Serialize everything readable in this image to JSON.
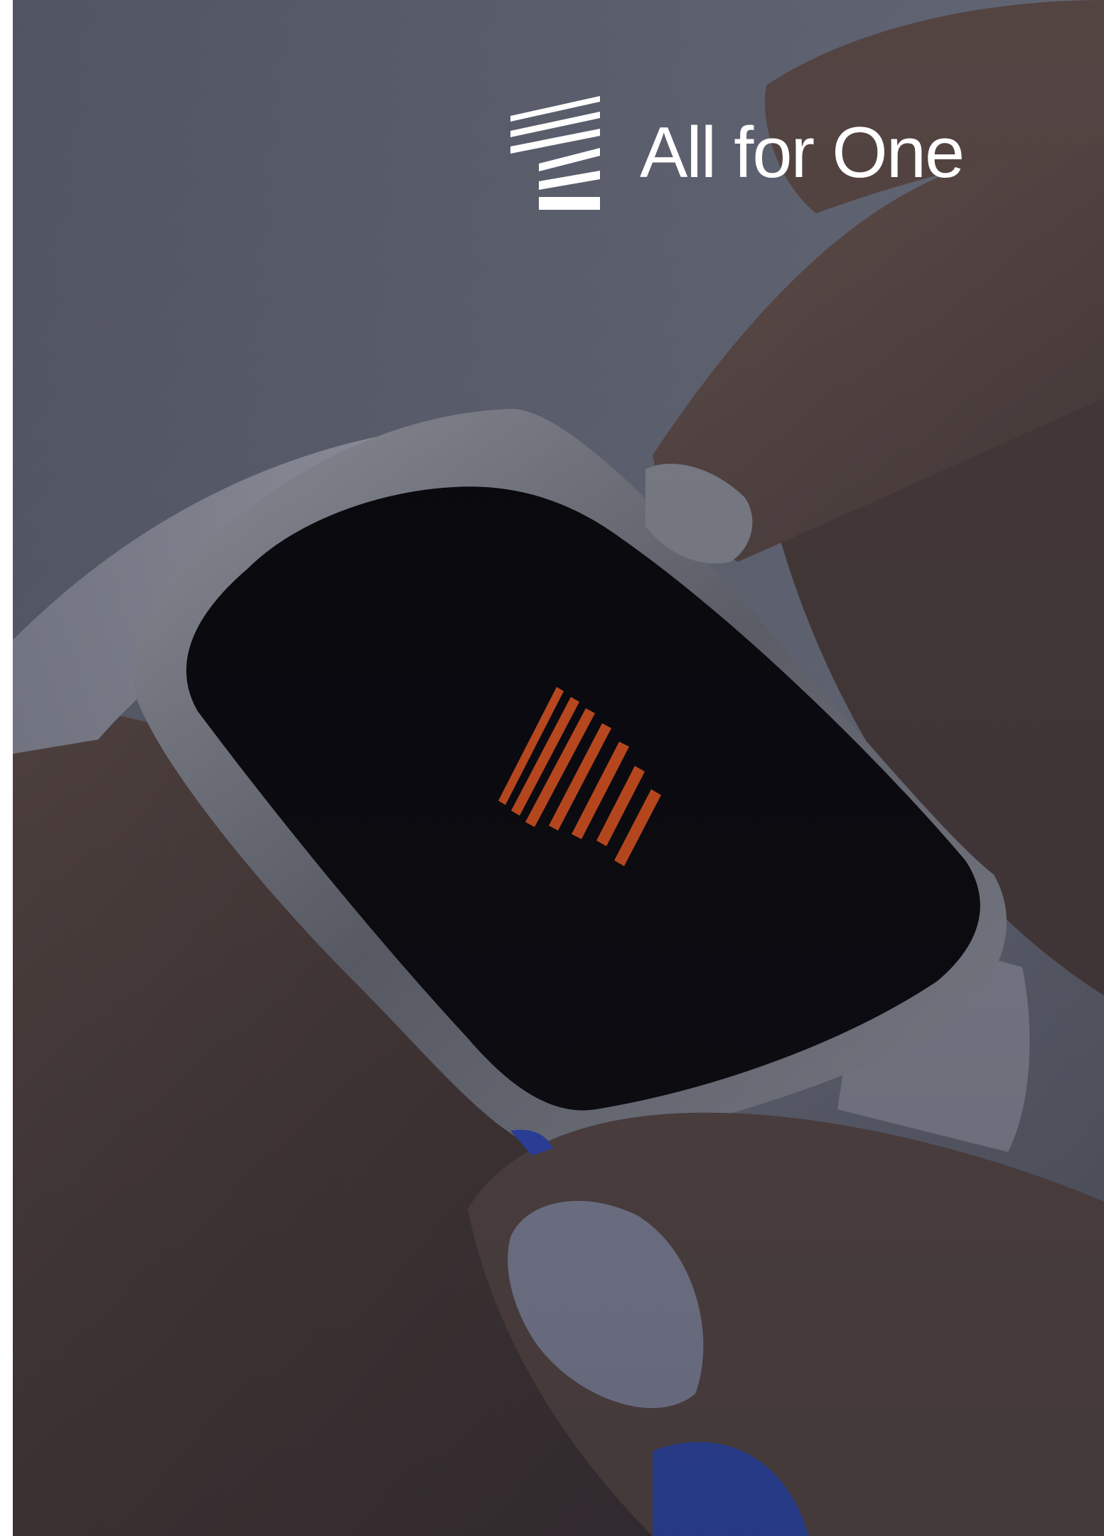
{
  "brand": {
    "name": "All for One",
    "logo_icon": "all-for-one-logo-icon",
    "logo_color": "#ffffff"
  },
  "photo": {
    "subject": "hand-with-smartwatch-photo",
    "screen_icon": "all-for-one-logo-icon",
    "screen_icon_color": "#e8541a",
    "overlay_color": "#1c1e2a"
  }
}
